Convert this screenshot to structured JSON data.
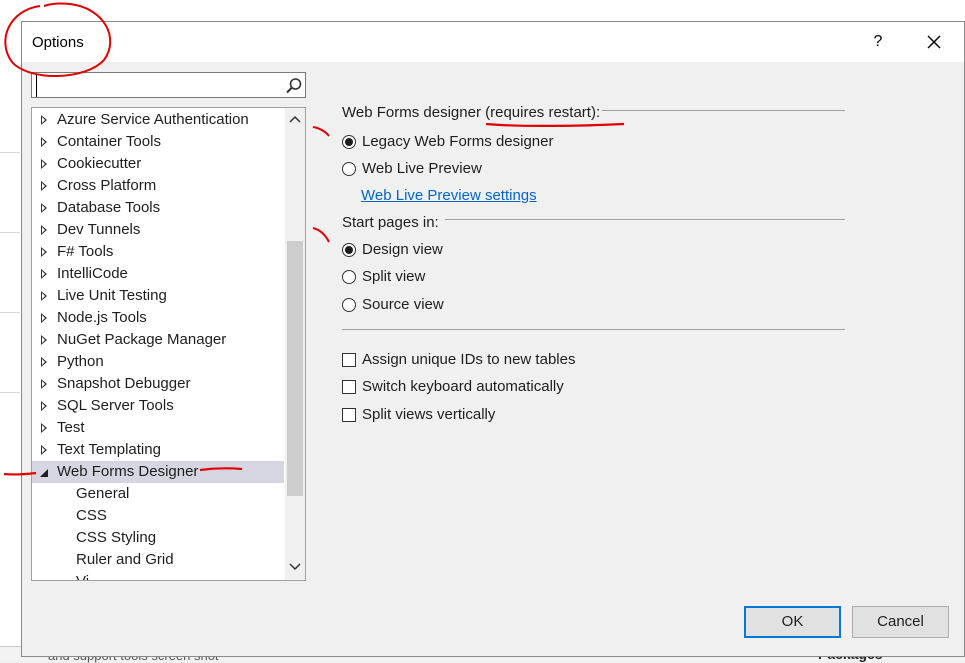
{
  "dialog": {
    "title": "Options",
    "help_label": "?",
    "close_label": "close"
  },
  "search": {
    "value": "",
    "placeholder": ""
  },
  "tree": {
    "items": [
      {
        "label": "Azure Service Authentication",
        "expanded": false
      },
      {
        "label": "Container Tools",
        "expanded": false
      },
      {
        "label": "Cookiecutter",
        "expanded": false
      },
      {
        "label": "Cross Platform",
        "expanded": false
      },
      {
        "label": "Database Tools",
        "expanded": false
      },
      {
        "label": "Dev Tunnels",
        "expanded": false
      },
      {
        "label": "F# Tools",
        "expanded": false
      },
      {
        "label": "IntelliCode",
        "expanded": false
      },
      {
        "label": "Live Unit Testing",
        "expanded": false
      },
      {
        "label": "Node.js Tools",
        "expanded": false
      },
      {
        "label": "NuGet Package Manager",
        "expanded": false
      },
      {
        "label": "Python",
        "expanded": false
      },
      {
        "label": "Snapshot Debugger",
        "expanded": false
      },
      {
        "label": "SQL Server Tools",
        "expanded": false
      },
      {
        "label": "Test",
        "expanded": false
      },
      {
        "label": "Text Templating",
        "expanded": false
      },
      {
        "label": "Web Forms Designer",
        "expanded": true,
        "selected": true
      }
    ],
    "children": [
      {
        "label": "General"
      },
      {
        "label": "CSS"
      },
      {
        "label": "CSS Styling"
      },
      {
        "label": "Ruler and Grid"
      },
      {
        "label": "Vi"
      }
    ]
  },
  "designer": {
    "label": "Web Forms designer (requires restart):",
    "options": [
      {
        "label": "Legacy Web Forms designer",
        "checked": true
      },
      {
        "label": "Web Live Preview",
        "checked": false
      }
    ],
    "settings_link": "Web Live Preview settings"
  },
  "start_pages": {
    "label": "Start pages in:",
    "options": [
      {
        "label": "Design view",
        "checked": true
      },
      {
        "label": "Split view",
        "checked": false
      },
      {
        "label": "Source view",
        "checked": false
      }
    ]
  },
  "checkboxes": [
    {
      "label": "Assign unique IDs to new tables",
      "checked": false
    },
    {
      "label": "Switch keyboard automatically",
      "checked": false
    },
    {
      "label": "Split views vertically",
      "checked": false
    }
  ],
  "buttons": {
    "ok": "OK",
    "cancel": "Cancel"
  },
  "background": {
    "bottom_left_text": "and support tools screen shot",
    "bottom_right_text": "Packages"
  },
  "colors": {
    "accent": "#0078d7",
    "link": "#0066cc",
    "selected_row": "#d6d6e2",
    "annotation": "#e00000"
  }
}
